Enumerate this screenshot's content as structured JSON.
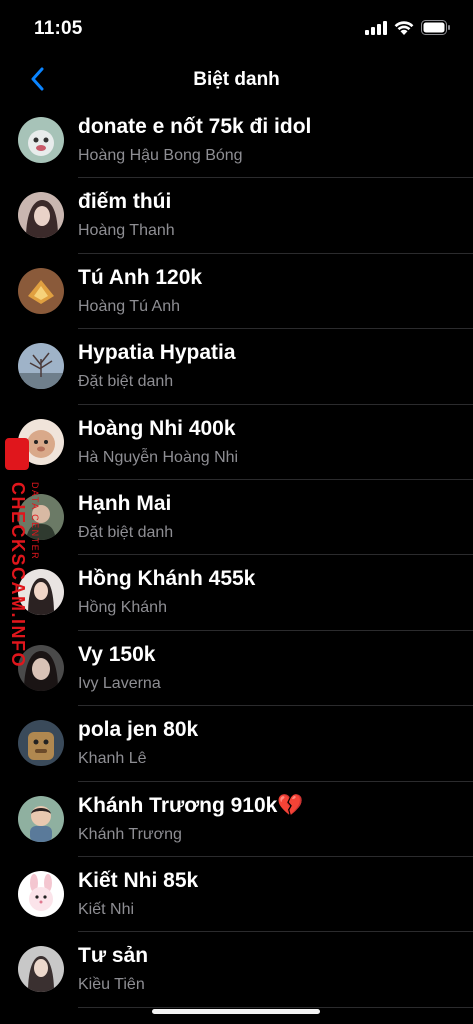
{
  "status": {
    "time": "11:05"
  },
  "nav": {
    "title": "Biệt danh"
  },
  "contacts": [
    {
      "nickname": "donate e nốt 75k đi idol",
      "name": "Hoàng Hậu Bong Bóng"
    },
    {
      "nickname": "điếm thúi",
      "name": "Hoàng Thanh"
    },
    {
      "nickname": "Tú Anh 120k",
      "name": "Hoàng Tú Anh"
    },
    {
      "nickname": "Hypatia Hypatia",
      "name": "Đặt biệt danh"
    },
    {
      "nickname": "Hoàng Nhi 400k",
      "name": "Hà Nguyễn Hoàng Nhi"
    },
    {
      "nickname": "Hạnh Mai",
      "name": "Đặt biệt danh"
    },
    {
      "nickname": "Hồng Khánh 455k",
      "name": "Hồng Khánh"
    },
    {
      "nickname": "Vy 150k",
      "name": "Ivy Laverna"
    },
    {
      "nickname": "pola jen 80k",
      "name": "Khanh Lê"
    },
    {
      "nickname": "Khánh Trương 910k💔",
      "name": "Khánh Trương"
    },
    {
      "nickname": "Kiết Nhi 85k",
      "name": "Kiết Nhi"
    },
    {
      "nickname": "Tư sản",
      "name": "Kiều Tiên"
    }
  ],
  "watermark": {
    "main": "CHECKSCAM.INFO",
    "sub": "DATA CENTER"
  },
  "colors": {
    "accent": "#0a84ff",
    "secondary_text": "#8e8e93",
    "watermark": "#e0161c"
  }
}
